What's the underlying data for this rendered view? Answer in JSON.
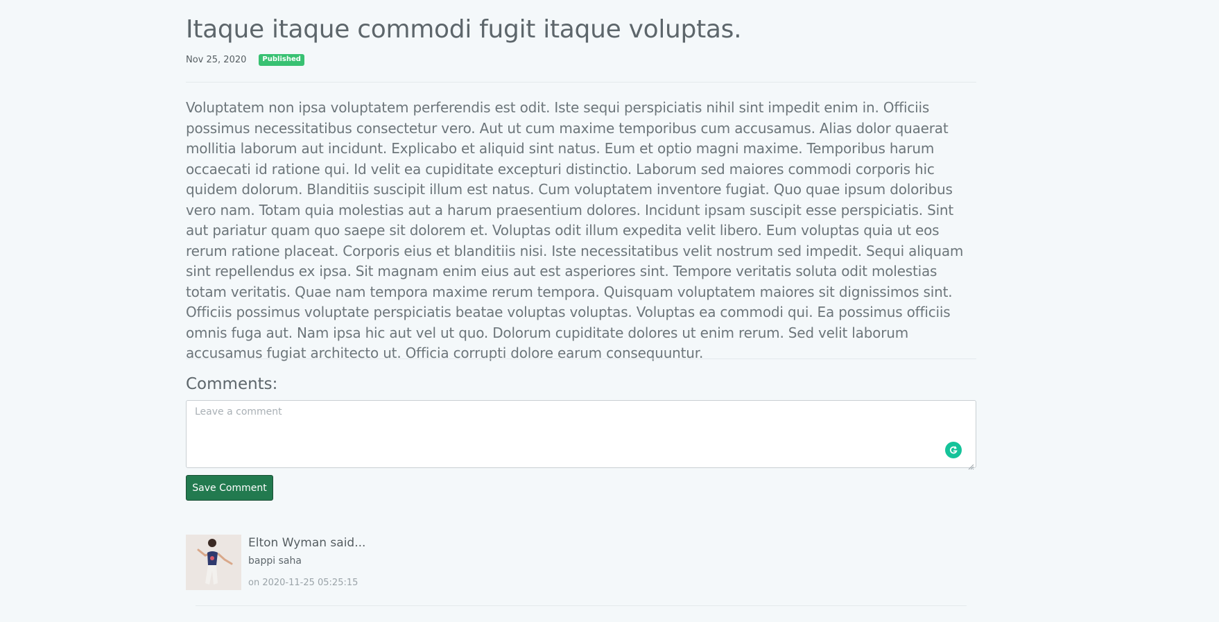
{
  "post": {
    "title": "Itaque itaque commodi fugit itaque voluptas.",
    "date": "Nov 25, 2020",
    "status": "Published",
    "body": "Voluptatem non ipsa voluptatem perferendis est odit. Iste sequi perspiciatis nihil sint impedit enim in. Officiis possimus necessitatibus consectetur vero. Aut ut cum maxime temporibus cum accusamus. Alias dolor quaerat mollitia laborum aut incidunt. Explicabo et aliquid sint natus. Eum et optio magni maxime. Temporibus harum occaecati id ratione qui. Id velit ea cupiditate excepturi distinctio. Laborum sed maiores commodi corporis hic quidem dolorum. Blanditiis suscipit illum est natus. Cum voluptatem inventore fugiat. Quo quae ipsum doloribus vero nam. Totam quia molestias aut a harum praesentium dolores. Incidunt ipsam suscipit esse perspiciatis. Sint aut pariatur quam quo saepe sit dolorem et. Voluptas odit illum expedita velit libero. Eum voluptas quia ut eos rerum ratione placeat. Corporis eius et blanditiis nisi. Iste necessitatibus velit nostrum sed impedit. Sequi aliquam sint repellendus ex ipsa. Sit magnam enim eius aut est asperiores sint. Tempore veritatis soluta odit molestias totam veritatis. Quae nam tempora maxime rerum tempora. Quisquam voluptatem maiores sit dignissimos sint. Officiis possimus voluptate perspiciatis beatae voluptas voluptas. Voluptas ea commodi qui. Ea possimus officiis omnis fuga aut. Nam ipsa hic aut vel ut quo. Dolorum cupiditate dolores ut enim rerum. Sed velit laborum accusamus fugiat architecto ut. Officia corrupti dolore earum consequuntur."
  },
  "comments_section": {
    "heading": "Comments:",
    "input": {
      "placeholder": "Leave a comment",
      "value": ""
    },
    "save_label": "Save Comment",
    "items": [
      {
        "author_line": "Elton Wyman said...",
        "text": "bappi saha",
        "time": "on 2020-11-25 05:25:15"
      }
    ]
  },
  "icons": {
    "grammar_assistant": "grammarly-icon",
    "resize": "resize-handle-icon"
  },
  "colors": {
    "background": "#f4f8fa",
    "badge": "#38c172",
    "button": "#227a4f",
    "grammar_icon": "#15c39a"
  }
}
